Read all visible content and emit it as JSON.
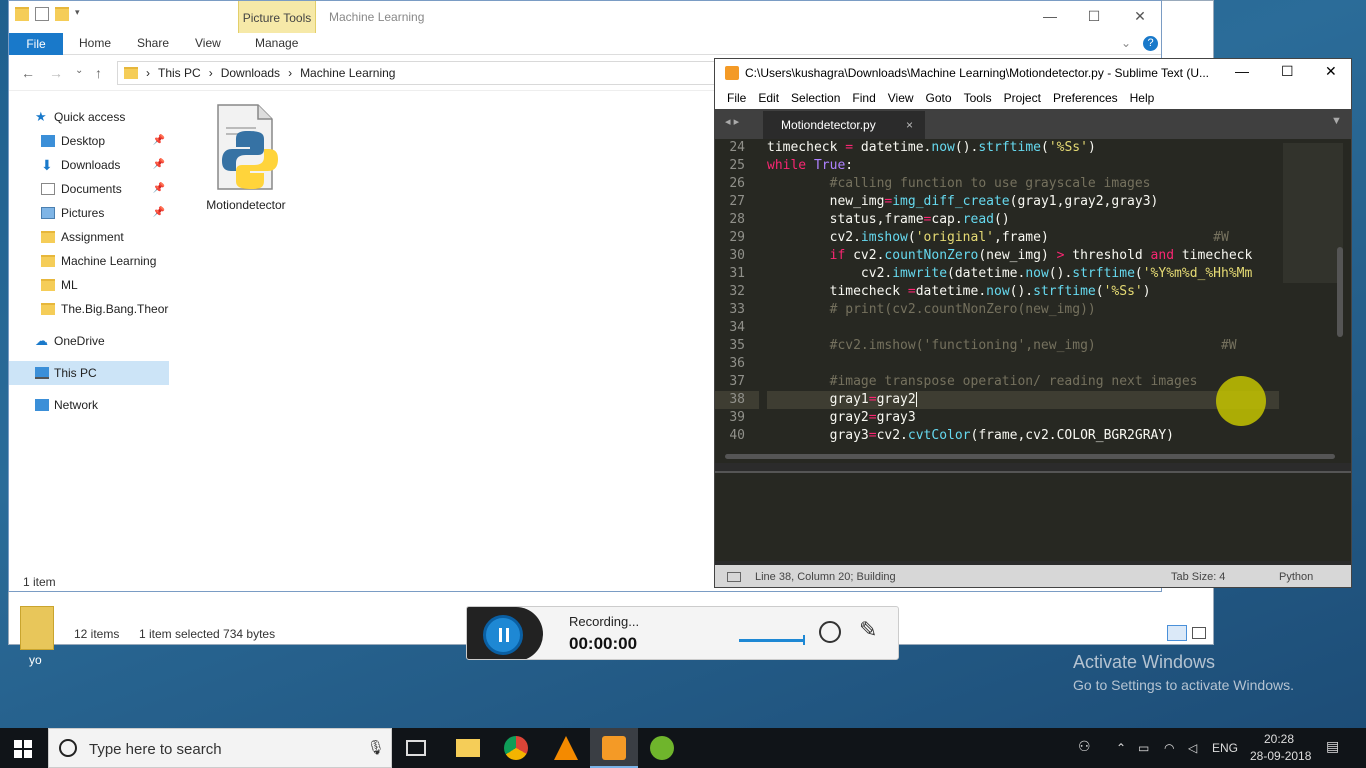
{
  "explorer": {
    "ribbon_context_tab": "Picture Tools",
    "title": "Machine Learning",
    "tabs": [
      "File",
      "Home",
      "Share",
      "View",
      "Manage"
    ],
    "breadcrumb": [
      "This PC",
      "Downloads",
      "Machine Learning"
    ],
    "quick_access": "Quick access",
    "sidebar": [
      {
        "label": "Desktop",
        "pinned": true
      },
      {
        "label": "Downloads",
        "pinned": true
      },
      {
        "label": "Documents",
        "pinned": true
      },
      {
        "label": "Pictures",
        "pinned": true
      },
      {
        "label": "Assignment",
        "pinned": false
      },
      {
        "label": "Machine Learning",
        "pinned": false
      },
      {
        "label": "ML",
        "pinned": false
      },
      {
        "label": "The.Big.Bang.Theor",
        "pinned": false
      }
    ],
    "onedrive": "OneDrive",
    "thispc": "This PC",
    "network": "Network",
    "file_name": "Motiondetector",
    "status_count": "1 item",
    "status_items": "12 items",
    "status_selected": "1 item selected  734 bytes",
    "pin_glyph": "📌"
  },
  "desktop": {
    "icon_label": "yo"
  },
  "sublime": {
    "title": "C:\\Users\\kushagra\\Downloads\\Machine Learning\\Motiondetector.py - Sublime Text (U...",
    "menu": [
      "File",
      "Edit",
      "Selection",
      "Find",
      "View",
      "Goto",
      "Tools",
      "Project",
      "Preferences",
      "Help"
    ],
    "tab_label": "Motiondetector.py",
    "tab_close": "×",
    "line_numbers": [
      "24",
      "25",
      "26",
      "27",
      "28",
      "29",
      "30",
      "31",
      "32",
      "33",
      "34",
      "35",
      "36",
      "37",
      "38",
      "39",
      "40"
    ],
    "status_left": "Line 38, Column 20; Building",
    "status_tab": "Tab Size: 4",
    "status_lang": "Python"
  },
  "recorder": {
    "label": "Recording...",
    "time": "00:00:00"
  },
  "watermark": {
    "line1": "Activate Windows",
    "line2": "Go to Settings to activate Windows."
  },
  "taskbar": {
    "search_placeholder": "Type here to search",
    "lang": "ENG",
    "time": "20:28",
    "date": "28-09-2018"
  }
}
